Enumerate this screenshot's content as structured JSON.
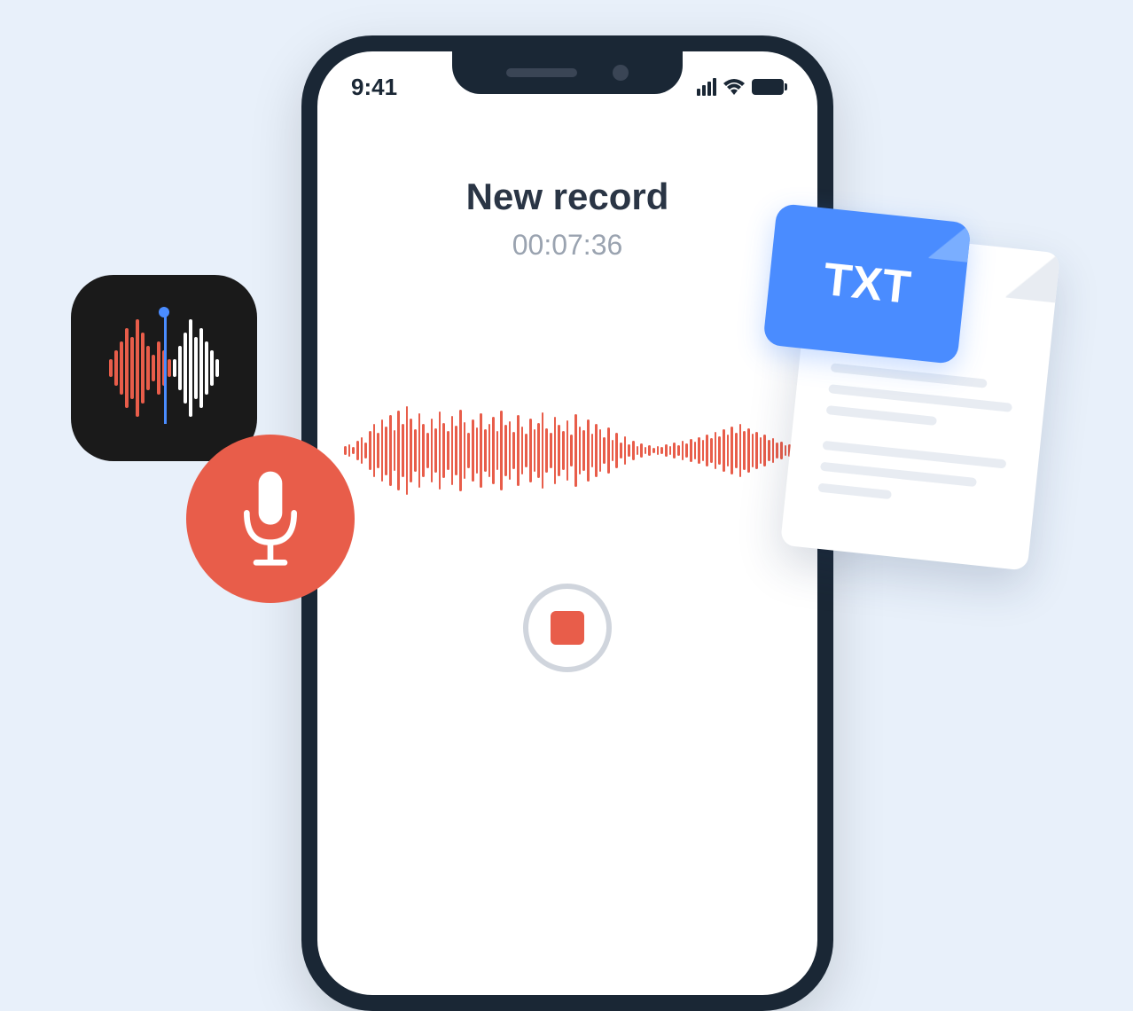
{
  "statusBar": {
    "time": "9:41"
  },
  "recording": {
    "title": "New record",
    "timer": "00:07:36"
  },
  "txtBadge": {
    "label": "TXT"
  },
  "icons": {
    "voiceMemo": "voice-memo-app-icon",
    "microphone": "microphone-icon",
    "stop": "stop-icon",
    "document": "text-document-icon"
  },
  "colors": {
    "accent": "#e85d4a",
    "blue": "#4a8cff",
    "dark": "#1a2735",
    "bg": "#e8f0fa"
  }
}
